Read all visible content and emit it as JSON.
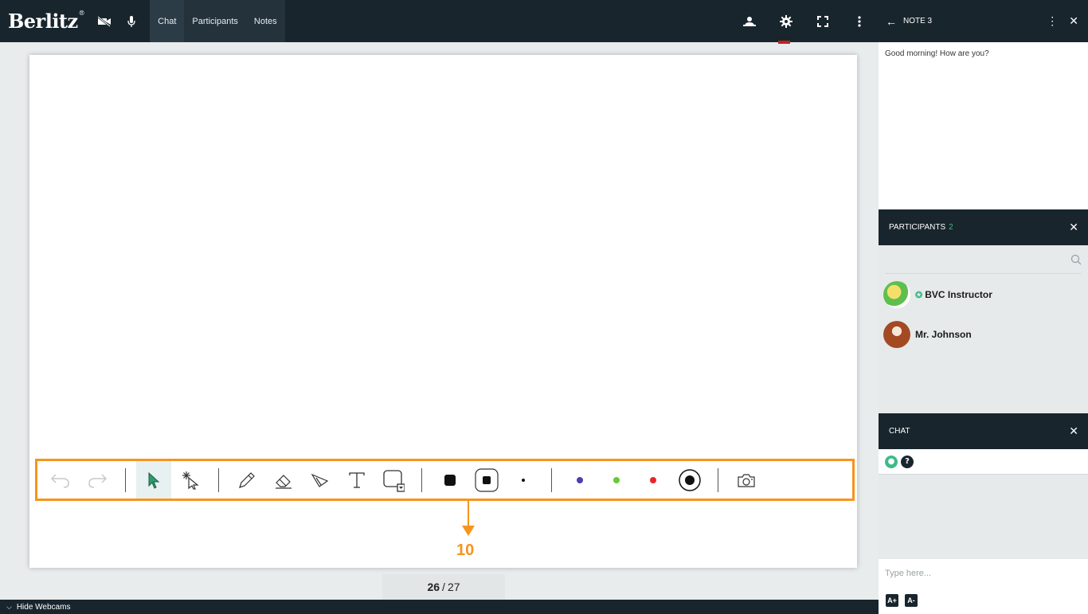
{
  "topbar": {
    "logo": "Berlitz",
    "logo_mark": "®",
    "tabs": [
      {
        "label": "Chat"
      },
      {
        "label": "Participants"
      },
      {
        "label": "Notes"
      }
    ]
  },
  "note": {
    "title": "NOTE 3",
    "content": "Good morning! How are you?"
  },
  "participants": {
    "title": "PARTICIPANTS",
    "count": "2",
    "list": [
      {
        "name": "BVC Instructor"
      },
      {
        "name": "Mr. Johnson"
      }
    ]
  },
  "chat": {
    "title": "CHAT",
    "placeholder": "Type here...",
    "font_increase": "A+",
    "font_decrease": "A-"
  },
  "annotation": {
    "number": "10",
    "color": "#f7941d"
  },
  "pager": {
    "current": "26",
    "separator": "/",
    "total": "27"
  },
  "bottombar": {
    "label": "Hide Webcams"
  },
  "colors": {
    "dark": "#18252d",
    "accent_green": "#3dbb88",
    "blue_dot": "#4a3fb3",
    "green_dot": "#67c83b",
    "red_dot": "#e8252b"
  }
}
